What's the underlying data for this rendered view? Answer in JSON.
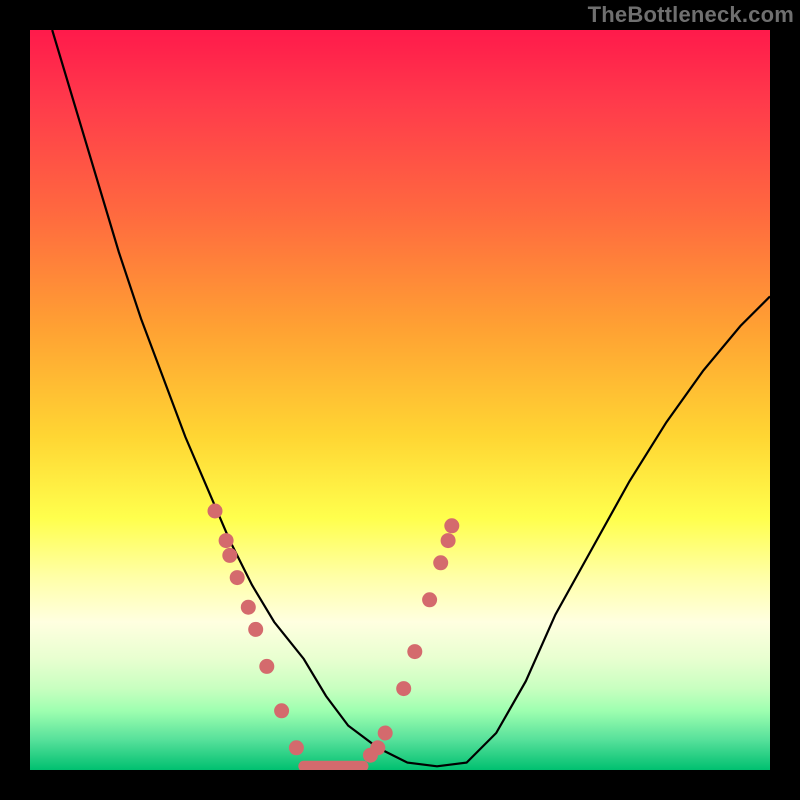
{
  "watermark": "TheBottleneck.com",
  "colors": {
    "dot": "#d46a6d",
    "curve": "#000000",
    "gradient_top": "#ff1a4b",
    "gradient_bottom": "#00c070"
  },
  "chart_data": {
    "type": "line",
    "title": "",
    "xlabel": "",
    "ylabel": "",
    "xlim": [
      0,
      100
    ],
    "ylim": [
      0,
      100
    ],
    "series": [
      {
        "name": "bottleneck-curve",
        "x": [
          3,
          6,
          9,
          12,
          15,
          18,
          21,
          24,
          27,
          30,
          33,
          37,
          40,
          43,
          47,
          51,
          55,
          59,
          63,
          67,
          71,
          76,
          81,
          86,
          91,
          96,
          100
        ],
        "y": [
          100,
          90,
          80,
          70,
          61,
          53,
          45,
          38,
          31,
          25,
          20,
          15,
          10,
          6,
          3,
          1,
          0.5,
          1,
          5,
          12,
          21,
          30,
          39,
          47,
          54,
          60,
          64
        ]
      }
    ],
    "flat_segment": {
      "x_start": 37,
      "x_end": 45,
      "y": 0.5
    },
    "highlight_points": {
      "left_branch": [
        {
          "x": 25.0,
          "y": 35
        },
        {
          "x": 26.5,
          "y": 31
        },
        {
          "x": 27.0,
          "y": 29
        },
        {
          "x": 28.0,
          "y": 26
        },
        {
          "x": 29.5,
          "y": 22
        },
        {
          "x": 30.5,
          "y": 19
        },
        {
          "x": 32.0,
          "y": 14
        },
        {
          "x": 34.0,
          "y": 8
        },
        {
          "x": 36.0,
          "y": 3
        }
      ],
      "right_branch": [
        {
          "x": 46.0,
          "y": 2
        },
        {
          "x": 47.0,
          "y": 3
        },
        {
          "x": 48.0,
          "y": 5
        },
        {
          "x": 50.5,
          "y": 11
        },
        {
          "x": 52.0,
          "y": 16
        },
        {
          "x": 54.0,
          "y": 23
        },
        {
          "x": 55.5,
          "y": 28
        },
        {
          "x": 56.5,
          "y": 31
        },
        {
          "x": 57.0,
          "y": 33
        }
      ]
    },
    "note": "Values are read from the plotted pixels; axes carry no labels so x and y are expressed on a 0–100 relative scale."
  }
}
